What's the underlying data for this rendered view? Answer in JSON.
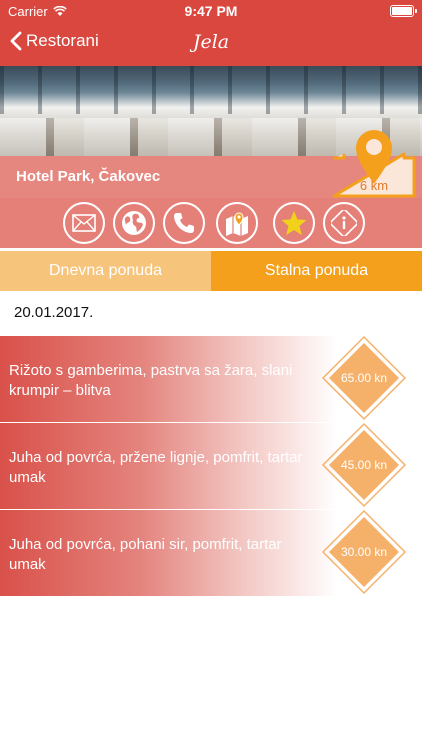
{
  "status_bar": {
    "carrier": "Carrier",
    "time": "9:47 PM"
  },
  "nav": {
    "back_label": "Restorani",
    "title": "Jela"
  },
  "restaurant": {
    "name": "Hotel Park, Čakovec",
    "distance": "6 km"
  },
  "action_icons": [
    "mail-icon",
    "globe-icon",
    "phone-icon",
    "map-icon",
    "star-icon",
    "info-icon"
  ],
  "tabs": [
    {
      "label": "Dnevna ponuda",
      "active": false
    },
    {
      "label": "Stalna ponuda",
      "active": true
    }
  ],
  "date": "20.01.2017.",
  "menu_items": [
    {
      "description": "Rižoto s gamberima, pastrva sa žara, slani krumpir – blitva",
      "price": "65.00 kn"
    },
    {
      "description": "Juha od povrća, pržene lignje, pomfrit, tartar umak",
      "price": "45.00 kn"
    },
    {
      "description": "Juha od povrća, pohani sir, pomfrit, tartar umak",
      "price": "30.00 kn"
    }
  ],
  "colors": {
    "nav_red": "#d9473e",
    "orange": "#f4a01c",
    "light_orange": "#f6c47b",
    "price_orange": "#f5b16a"
  }
}
